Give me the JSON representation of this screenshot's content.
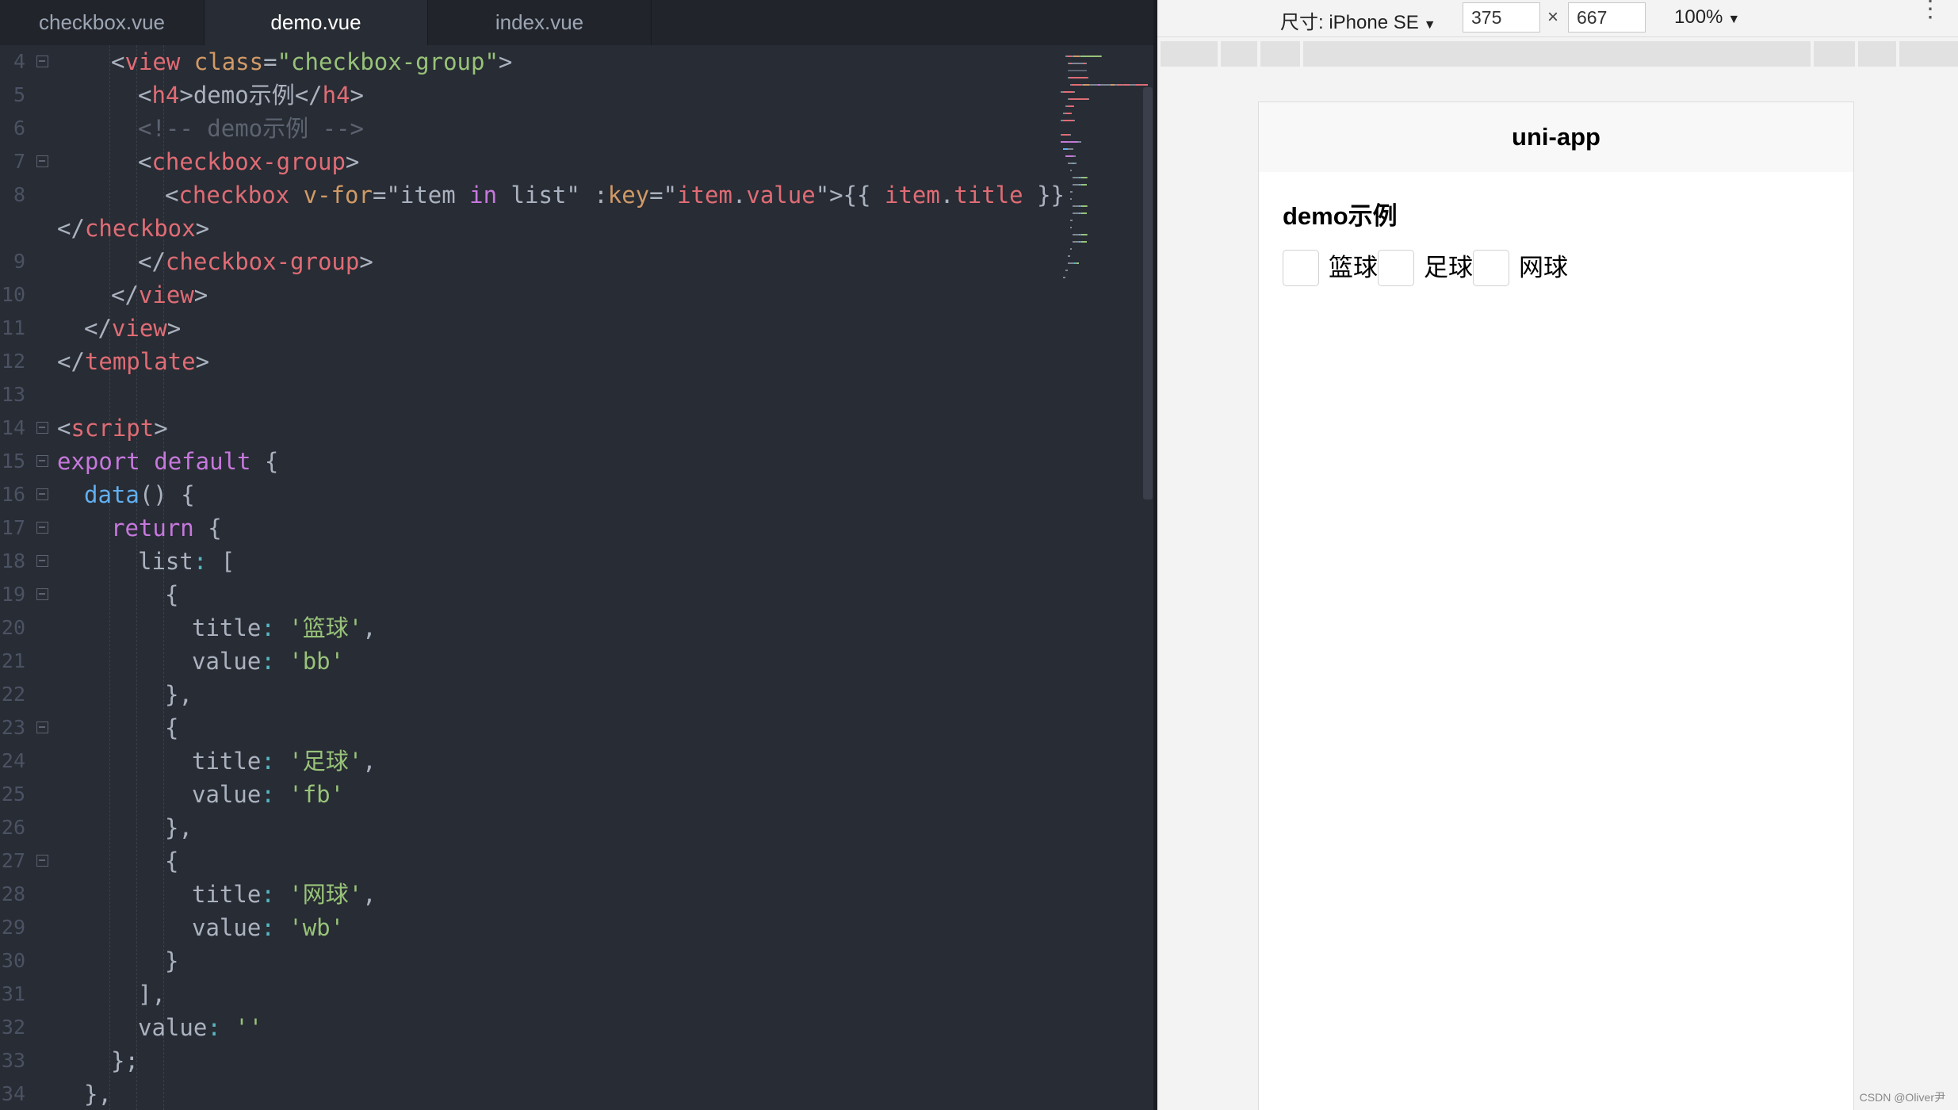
{
  "tabs": [
    {
      "label": "checkbox.vue",
      "active": false
    },
    {
      "label": "demo.vue",
      "active": true
    },
    {
      "label": "index.vue",
      "active": false
    }
  ],
  "code_lines": [
    {
      "n": "4",
      "fold": true,
      "indent": 2,
      "spans": [
        [
          "p",
          "<"
        ],
        [
          "t",
          "view"
        ],
        [
          "p",
          " "
        ],
        [
          "a",
          "class"
        ],
        [
          "p",
          "="
        ],
        [
          "s",
          "\"checkbox-group\""
        ],
        [
          "p",
          ">"
        ]
      ]
    },
    {
      "n": "5",
      "fold": false,
      "indent": 3,
      "spans": [
        [
          "p",
          "<"
        ],
        [
          "t",
          "h4"
        ],
        [
          "p",
          ">demo示例</"
        ],
        [
          "t",
          "h4"
        ],
        [
          "p",
          ">"
        ]
      ]
    },
    {
      "n": "6",
      "fold": false,
      "indent": 3,
      "spans": [
        [
          "c",
          "<!-- demo示例 -->"
        ]
      ]
    },
    {
      "n": "7",
      "fold": true,
      "indent": 3,
      "spans": [
        [
          "p",
          "<"
        ],
        [
          "t",
          "checkbox-group"
        ],
        [
          "p",
          ">"
        ]
      ]
    },
    {
      "n": "8",
      "fold": false,
      "indent": 4,
      "spans": [
        [
          "p",
          "<"
        ],
        [
          "t",
          "checkbox"
        ],
        [
          "p",
          " "
        ],
        [
          "a",
          "v-for"
        ],
        [
          "p",
          "=\"item "
        ],
        [
          "k",
          "in"
        ],
        [
          "p",
          " list\" :"
        ],
        [
          "a",
          "key"
        ],
        [
          "p",
          "=\""
        ],
        [
          "t",
          "item"
        ],
        [
          "p",
          "."
        ],
        [
          "t",
          "value"
        ],
        [
          "p",
          "\">{{ "
        ],
        [
          "t",
          "item"
        ],
        [
          "p",
          "."
        ],
        [
          "t",
          "title"
        ],
        [
          "p",
          " }}"
        ]
      ]
    },
    {
      "n": "",
      "fold": false,
      "indent": 0,
      "spans": [
        [
          "p",
          "</"
        ],
        [
          "t",
          "checkbox"
        ],
        [
          "p",
          ">"
        ]
      ]
    },
    {
      "n": "9",
      "fold": false,
      "indent": 3,
      "spans": [
        [
          "p",
          "</"
        ],
        [
          "t",
          "checkbox-group"
        ],
        [
          "p",
          ">"
        ]
      ]
    },
    {
      "n": "10",
      "fold": false,
      "indent": 2,
      "spans": [
        [
          "p",
          "</"
        ],
        [
          "t",
          "view"
        ],
        [
          "p",
          ">"
        ]
      ]
    },
    {
      "n": "11",
      "fold": false,
      "indent": 1,
      "spans": [
        [
          "p",
          "</"
        ],
        [
          "t",
          "view"
        ],
        [
          "p",
          ">"
        ]
      ]
    },
    {
      "n": "12",
      "fold": false,
      "indent": 0,
      "spans": [
        [
          "p",
          "</"
        ],
        [
          "t",
          "template"
        ],
        [
          "p",
          ">"
        ]
      ]
    },
    {
      "n": "13",
      "fold": false,
      "indent": 0,
      "spans": []
    },
    {
      "n": "14",
      "fold": true,
      "indent": 0,
      "spans": [
        [
          "p",
          "<"
        ],
        [
          "t",
          "script"
        ],
        [
          "p",
          ">"
        ]
      ]
    },
    {
      "n": "15",
      "fold": true,
      "indent": 0,
      "spans": [
        [
          "k",
          "export"
        ],
        [
          "p",
          " "
        ],
        [
          "k",
          "default"
        ],
        [
          "p",
          " {"
        ]
      ]
    },
    {
      "n": "16",
      "fold": true,
      "indent": 1,
      "spans": [
        [
          "f",
          "data"
        ],
        [
          "p",
          "() {"
        ]
      ]
    },
    {
      "n": "17",
      "fold": true,
      "indent": 2,
      "spans": [
        [
          "k",
          "return"
        ],
        [
          "p",
          " {"
        ]
      ]
    },
    {
      "n": "18",
      "fold": true,
      "indent": 3,
      "spans": [
        [
          "p",
          "list"
        ],
        [
          "o",
          ":"
        ],
        [
          "p",
          " ["
        ]
      ]
    },
    {
      "n": "19",
      "fold": true,
      "indent": 4,
      "spans": [
        [
          "p",
          "{"
        ]
      ]
    },
    {
      "n": "20",
      "fold": false,
      "indent": 5,
      "spans": [
        [
          "p",
          "title"
        ],
        [
          "o",
          ":"
        ],
        [
          "p",
          " "
        ],
        [
          "s",
          "'篮球'"
        ],
        [
          "p",
          ","
        ]
      ]
    },
    {
      "n": "21",
      "fold": false,
      "indent": 5,
      "spans": [
        [
          "p",
          "value"
        ],
        [
          "o",
          ":"
        ],
        [
          "p",
          " "
        ],
        [
          "s",
          "'bb'"
        ]
      ]
    },
    {
      "n": "22",
      "fold": false,
      "indent": 4,
      "spans": [
        [
          "p",
          "},"
        ]
      ]
    },
    {
      "n": "23",
      "fold": true,
      "indent": 4,
      "spans": [
        [
          "p",
          "{"
        ]
      ]
    },
    {
      "n": "24",
      "fold": false,
      "indent": 5,
      "spans": [
        [
          "p",
          "title"
        ],
        [
          "o",
          ":"
        ],
        [
          "p",
          " "
        ],
        [
          "s",
          "'足球'"
        ],
        [
          "p",
          ","
        ]
      ]
    },
    {
      "n": "25",
      "fold": false,
      "indent": 5,
      "spans": [
        [
          "p",
          "value"
        ],
        [
          "o",
          ":"
        ],
        [
          "p",
          " "
        ],
        [
          "s",
          "'fb'"
        ]
      ]
    },
    {
      "n": "26",
      "fold": false,
      "indent": 4,
      "spans": [
        [
          "p",
          "},"
        ]
      ]
    },
    {
      "n": "27",
      "fold": true,
      "indent": 4,
      "spans": [
        [
          "p",
          "{"
        ]
      ]
    },
    {
      "n": "28",
      "fold": false,
      "indent": 5,
      "spans": [
        [
          "p",
          "title"
        ],
        [
          "o",
          ":"
        ],
        [
          "p",
          " "
        ],
        [
          "s",
          "'网球'"
        ],
        [
          "p",
          ","
        ]
      ]
    },
    {
      "n": "29",
      "fold": false,
      "indent": 5,
      "spans": [
        [
          "p",
          "value"
        ],
        [
          "o",
          ":"
        ],
        [
          "p",
          " "
        ],
        [
          "s",
          "'wb'"
        ]
      ]
    },
    {
      "n": "30",
      "fold": false,
      "indent": 4,
      "spans": [
        [
          "p",
          "}"
        ]
      ]
    },
    {
      "n": "31",
      "fold": false,
      "indent": 3,
      "spans": [
        [
          "p",
          "],"
        ]
      ]
    },
    {
      "n": "32",
      "fold": false,
      "indent": 3,
      "spans": [
        [
          "p",
          "value"
        ],
        [
          "o",
          ":"
        ],
        [
          "p",
          " "
        ],
        [
          "s",
          "''"
        ]
      ]
    },
    {
      "n": "33",
      "fold": false,
      "indent": 2,
      "spans": [
        [
          "p",
          "};"
        ]
      ]
    },
    {
      "n": "34",
      "fold": false,
      "indent": 1,
      "spans": [
        [
          "p",
          "},"
        ]
      ]
    }
  ],
  "devtools": {
    "device_label": "尺寸: iPhone SE",
    "width_value": "375",
    "times": "×",
    "height_value": "667",
    "zoom": "100%",
    "caret": "▼",
    "menu": "⋮"
  },
  "app": {
    "nav_title": "uni-app",
    "heading": "demo示例",
    "checkboxes": [
      {
        "label": "篮球",
        "checked": false
      },
      {
        "label": "足球",
        "checked": false
      },
      {
        "label": "网球",
        "checked": false
      }
    ]
  },
  "watermark": "CSDN @Oliver尹",
  "colors": {
    "editor_bg": "#282c34",
    "tag": "#e06c75",
    "attribute": "#d19a66",
    "string": "#98c379",
    "keyword": "#c678dd",
    "function": "#61afef",
    "comment": "#5c6370"
  }
}
